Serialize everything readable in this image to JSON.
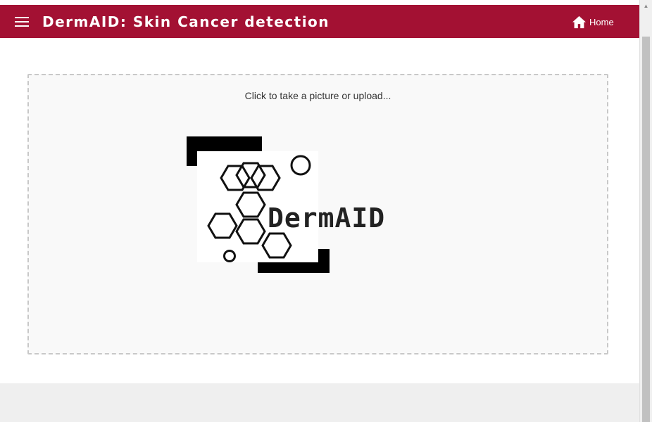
{
  "app_bar": {
    "title": "DermAID: Skin Cancer detection",
    "menu_icon": "hamburger-menu-icon",
    "home": {
      "icon": "home-icon",
      "label": "Home"
    },
    "color": "#a31133"
  },
  "upload": {
    "prompt": "Click to take a picture or upload...",
    "logo_text": "DermAID"
  },
  "colors": {
    "accent": "#a31133",
    "dropzone_border": "#c8c8c8"
  }
}
